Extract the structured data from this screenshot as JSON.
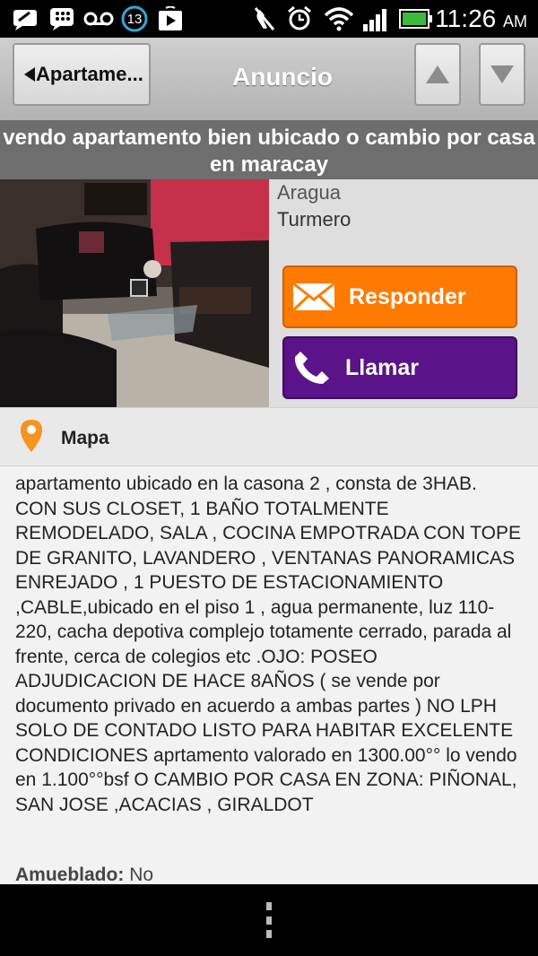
{
  "status_bar": {
    "notification_count": "13",
    "time": "11:26",
    "ampm": "AM"
  },
  "app_bar": {
    "back_label": "Apartame...",
    "title": "Anuncio"
  },
  "listing": {
    "title": "vendo apartamento bien ubicado o cambio por casa en maracay",
    "state": "Aragua",
    "city": "Turmero",
    "reply_label": "Responder",
    "call_label": "Llamar",
    "map_label": "Mapa",
    "description": "apartamento ubicado en la casona 2 , consta de 3HAB. CON SUS CLOSET, 1 BAÑO TOTALMENTE REMODELADO, SALA , COCINA EMPOTRADA CON TOPE DE GRANITO, LAVANDERO , VENTANAS PANORAMICAS ENREJADO , 1 PUESTO DE ESTACIONAMIENTO ,CABLE,ubicado en el piso 1 , agua permanente, luz 110-220, cacha depotiva complejo totamente cerrado, parada al frente, cerca de colegios etc .OJO: POSEO ADJUDICACION DE HACE 8AÑOS ( se vende por documento privado en acuerdo a ambas partes ) NO LPH SOLO DE CONTADO LISTO PARA HABITAR EXCELENTE CONDICIONES  aprtamento valorado en 1300.00°° lo vendo en 1.100°°bsf  O CAMBIO POR CASA EN ZONA: PIÑONAL, SAN JOSE ,ACACIAS , GIRALDOT",
    "furnished_label": "Amueblado:",
    "furnished_value": "No"
  },
  "colors": {
    "reply_button": "#ff7a00",
    "call_button": "#5b1389",
    "map_pin": "#f7931e"
  },
  "icons": [
    "message-icon",
    "bbm-icon",
    "voicemail-icon",
    "play-store-icon",
    "mute-icon",
    "alarm-icon",
    "wifi-icon",
    "signal-icon",
    "battery-icon",
    "envelope-icon",
    "phone-icon",
    "map-pin-icon",
    "menu-dots-icon"
  ]
}
